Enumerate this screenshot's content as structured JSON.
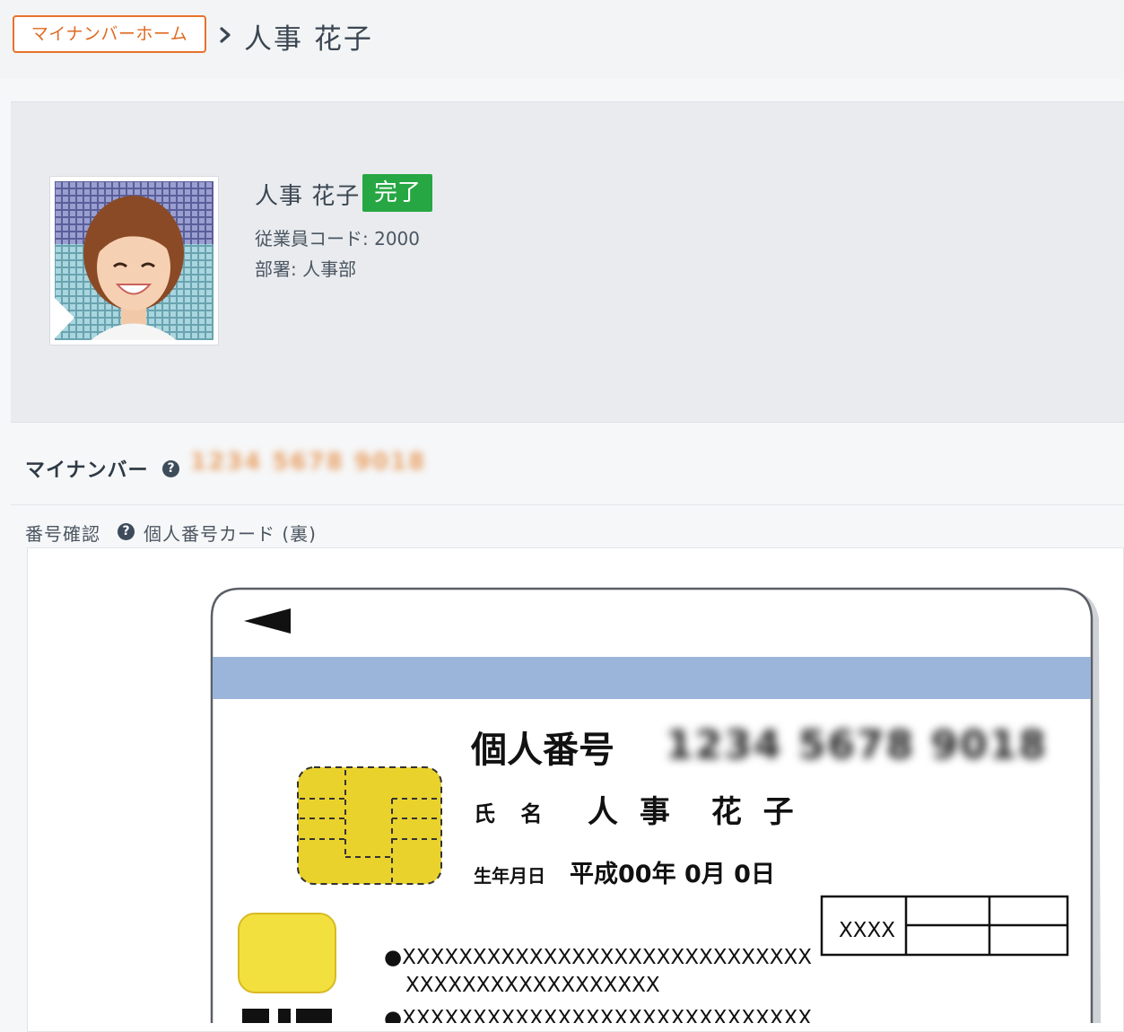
{
  "breadcrumb": {
    "home_label": "マイナンバーホーム",
    "current": "人事 花子"
  },
  "employee": {
    "name": "人事 花子",
    "status": "完了",
    "code_line": "従業員コード: 2000",
    "dept_line": "部署: 人事部"
  },
  "mynumber": {
    "label": "マイナンバー",
    "value": "1234 5678 9018",
    "help_icon": "?"
  },
  "verification": {
    "label": "番号確認",
    "help_icon": "?",
    "document_type": "個人番号カード (裏)"
  },
  "card": {
    "number_label": "個人番号",
    "number_value": "1234 5678 9018",
    "name_label": "氏 名",
    "name_value": "人 事　花 子",
    "dob_label": "生年月日",
    "dob_value": "平成00年 0月 0日",
    "box_label": "XXXX",
    "line1": "●XXXXXXXXXXXXXXXXXXXXXXXXXXXXX",
    "line2": "XXXXXXXXXXXXXXXXXX",
    "line3": "●XXXXXXXXXXXXXXXXXXXXXXXXXXXXX",
    "colors": {
      "stripe": "#9bb5da",
      "chip": "#ead22c",
      "chip_small": "#f2e03e"
    }
  },
  "colors": {
    "accent": "#e8722c",
    "badge": "#27a743"
  }
}
